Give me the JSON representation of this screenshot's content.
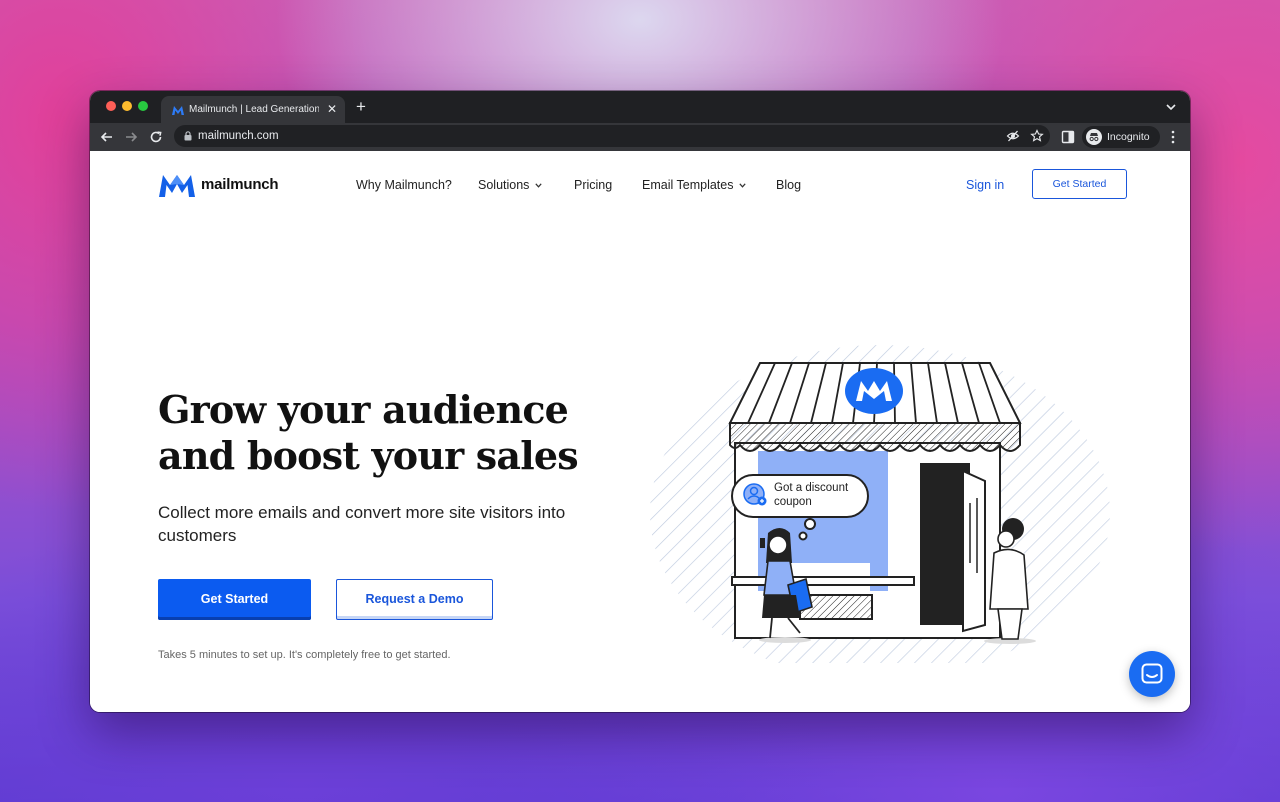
{
  "browser": {
    "tab_title": "Mailmunch | Lead Generation a",
    "url": "mailmunch.com",
    "profile_label": "Incognito"
  },
  "header": {
    "logo_text": "mailmunch",
    "nav": {
      "why": "Why Mailmunch?",
      "solutions": "Solutions",
      "pricing": "Pricing",
      "email_templates": "Email Templates",
      "blog": "Blog"
    },
    "sign_in": "Sign in",
    "cta": "Get Started"
  },
  "hero": {
    "title_line1": "Grow your audience",
    "title_line2": "and boost your sales",
    "subtitle": "Collect more emails and convert more site visitors into customers",
    "primary_cta": "Get Started",
    "secondary_cta": "Request a Demo",
    "note": "Takes 5 minutes to set up. It's completely free to get started."
  },
  "illustration": {
    "bubble_line1": "Got a discount",
    "bubble_line2": "coupon"
  },
  "colors": {
    "accent": "#0b5bf0",
    "link": "#1a56db",
    "illustration_blue": "#8fb0f7"
  }
}
